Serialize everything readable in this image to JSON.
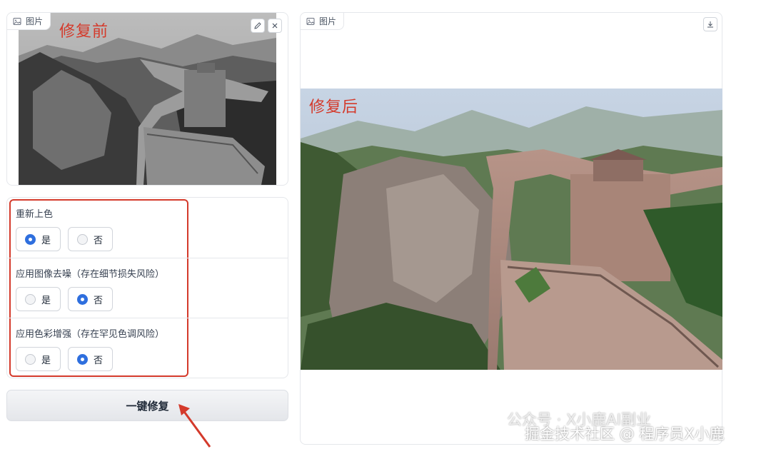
{
  "input_panel": {
    "tag_label": "图片",
    "overlay_label": "修复前"
  },
  "options": [
    {
      "title": "重新上色",
      "choices": [
        "是",
        "否"
      ],
      "selected": 0
    },
    {
      "title": "应用图像去噪（存在细节损失风险）",
      "choices": [
        "是",
        "否"
      ],
      "selected": 1
    },
    {
      "title": "应用色彩增强（存在罕见色调风险）",
      "choices": [
        "是",
        "否"
      ],
      "selected": 1
    }
  ],
  "action": {
    "label": "一键修复"
  },
  "output_panel": {
    "tag_label": "图片",
    "overlay_label": "修复后"
  },
  "watermark": {
    "line1": "公众号 · X小鹿AI副业",
    "line2": "掘金技术社区 @ 程序员X小鹿"
  },
  "colors": {
    "annotation_red": "#d43a2b",
    "radio_selected": "#2f6fde"
  }
}
